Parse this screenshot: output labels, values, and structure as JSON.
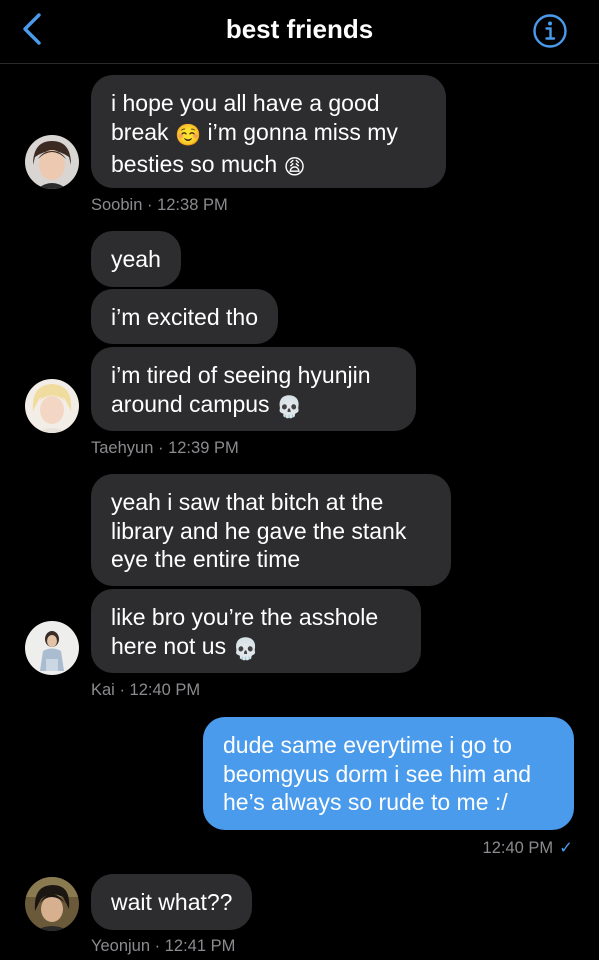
{
  "header": {
    "title": "best friends",
    "back_icon": "chevron-left-icon",
    "info_icon": "info-icon",
    "accent": "#4a9bec"
  },
  "messages": {
    "m1": {
      "line1": "i hope you all have a good",
      "line2a": "break",
      "emoji2": "☺️",
      "line2b": "i’m gonna miss my",
      "line3a": "besties so much",
      "emoji3": "😩"
    },
    "m1_meta": {
      "sender": "Soobin",
      "sep": "·",
      "time": "12:38 PM"
    },
    "m2": {
      "line1": "yeah"
    },
    "m3": {
      "line1": "i’m excited tho"
    },
    "m4": {
      "line1": "i’m tired of seeing hyunjin",
      "line2a": "around campus",
      "emoji2": "💀"
    },
    "m4_meta": {
      "sender": "Taehyun",
      "sep": "·",
      "time": "12:39 PM"
    },
    "m5": {
      "line1": "yeah i saw that bitch at the",
      "line2": "library and he gave the stank",
      "line3": "eye the entire time"
    },
    "m6": {
      "line1": "like bro you’re the asshole",
      "line2a": "here not us",
      "emoji2": "💀"
    },
    "m6_meta": {
      "sender": "Kai",
      "sep": "·",
      "time": "12:40 PM"
    },
    "m7": {
      "line1": "dude same everytime i go to",
      "line2": "beomgyus dorm i see him and",
      "line3": "he’s always so rude to me :/"
    },
    "m7_meta": {
      "time": "12:40 PM",
      "check": "✓"
    },
    "m8": {
      "line1": "wait what??"
    },
    "m8_meta": {
      "sender": "Yeonjun",
      "sep": "·",
      "time": "12:41 PM"
    }
  },
  "colors": {
    "background": "#000000",
    "incoming_bubble": "#2d2d2f",
    "outgoing_bubble": "#4a9bec",
    "meta_text": "#8b8b8f"
  }
}
